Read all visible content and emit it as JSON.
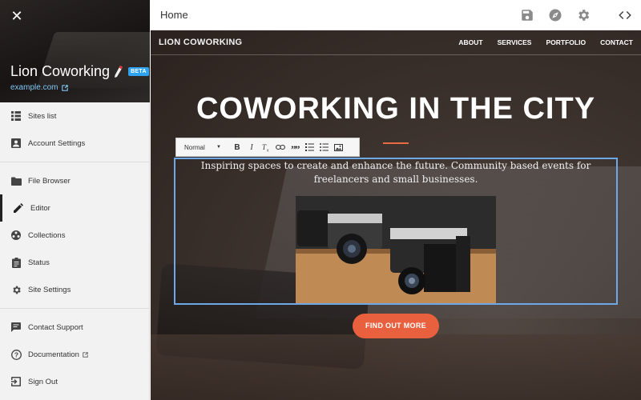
{
  "sidebar": {
    "site_title": "Lion Coworking",
    "beta_badge": "BETA",
    "site_url": "example.com",
    "items": [
      {
        "label": "Sites list",
        "icon": "grid-icon"
      },
      {
        "label": "Account Settings",
        "icon": "account-box-icon"
      },
      {
        "label": "File Browser",
        "icon": "folder-icon"
      },
      {
        "label": "Editor",
        "icon": "pencil-icon",
        "active": true
      },
      {
        "label": "Collections",
        "icon": "collections-icon"
      },
      {
        "label": "Status",
        "icon": "clipboard-icon"
      },
      {
        "label": "Site Settings",
        "icon": "gear-icon"
      },
      {
        "label": "Contact Support",
        "icon": "chat-icon"
      },
      {
        "label": "Documentation",
        "icon": "help-icon"
      },
      {
        "label": "Sign Out",
        "icon": "sign-out-icon"
      }
    ]
  },
  "topbar": {
    "page_name": "Home",
    "icons": [
      "save-icon",
      "compass-icon",
      "gear-icon",
      "code-icon"
    ]
  },
  "site": {
    "brand": "LION COWORKING",
    "menu": [
      "ABOUT",
      "SERVICES",
      "PORTFOLIO",
      "CONTACT"
    ],
    "hero_title": "COWORKING IN THE CITY",
    "hero_text": "Inspiring spaces to create and enhance the future. Community based events for freelancers and small businesses.",
    "cta": "FIND OUT MORE"
  },
  "editor_toolbar": {
    "format_select": "Normal",
    "buttons": [
      "B",
      "I",
      "Tx",
      "link",
      "quote",
      "ordered-list",
      "unordered-list",
      "image"
    ]
  },
  "colors": {
    "accent": "#e9603f",
    "selection": "#6fa8e6",
    "beta": "#2ea3f2",
    "link": "#7fc7f4"
  }
}
